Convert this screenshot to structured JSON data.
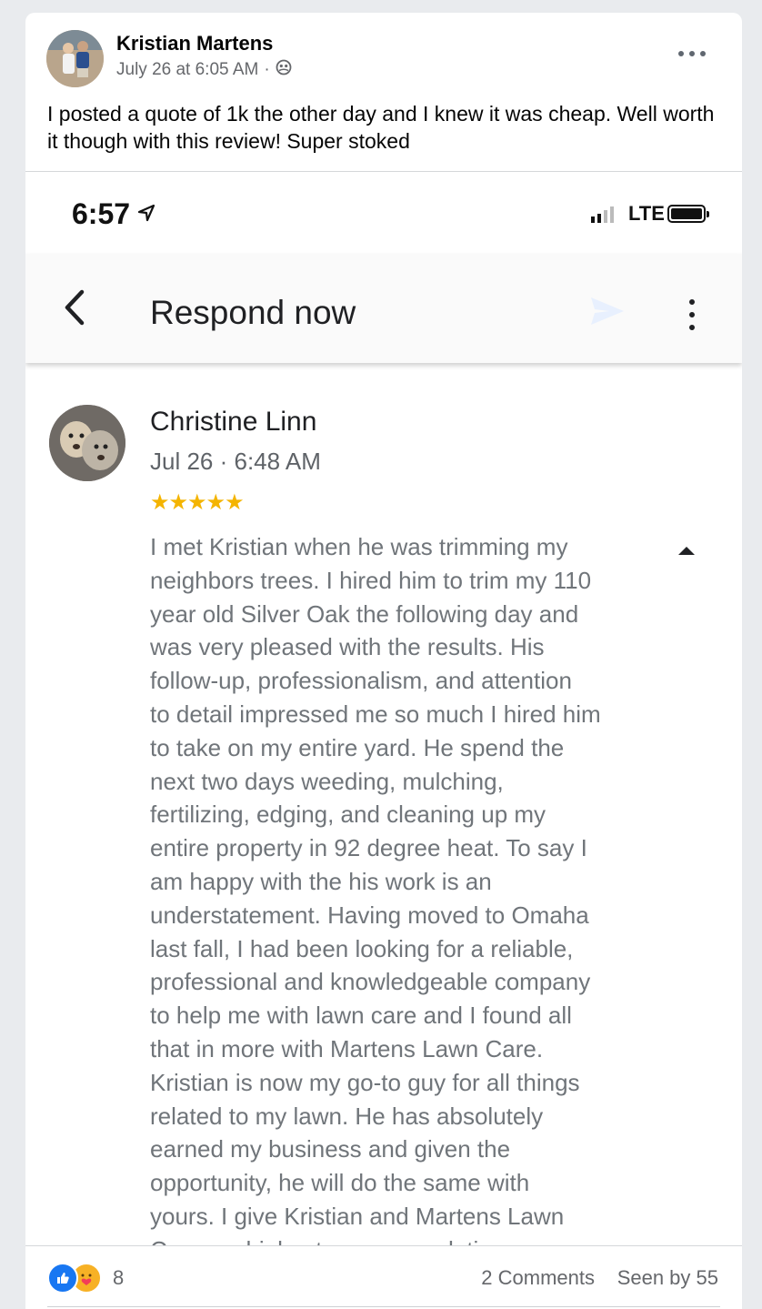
{
  "post": {
    "author": "Kristian Martens",
    "timestamp": "July 26 at 6:05 AM",
    "separator": "·",
    "audience_icon": "friends-icon",
    "text": "I posted a quote of 1k the other day and I knew it was cheap. Well worth it though with this review! Super stoked"
  },
  "phone": {
    "time": "6:57",
    "network": "LTE"
  },
  "app_bar": {
    "title": "Respond now"
  },
  "review": {
    "name": "Christine Linn",
    "date": "Jul 26 · 6:48 AM",
    "stars": "★★★★★",
    "rating": 5,
    "text": "I met Kristian when he was trimming my\nneighbors trees. I hired him to trim my 110\nyear old Silver Oak the following day and\nwas very pleased with the results.  His\nfollow-up, professionalism, and attention\nto detail impressed me so much I hired him\nto take on my entire yard. He spend the\nnext two days weeding, mulching,\nfertilizing, edging, and cleaning up my\nentire property in 92 degree heat. To say I\nam happy with the his work is an\nunderstatement. Having moved to Omaha\nlast fall, I had been looking for a reliable,\nprofessional and knowledgeable company\nto help me with lawn care and I found all\nthat in more with Martens Lawn Care.\nKristian is now my go-to guy for all things\nrelated to my lawn. He has absolutely\nearned my business and given the\nopportunity, he will do the same with\nyours. I give Kristian and Martens Lawn\nCare my highest recommendation."
  },
  "footer": {
    "reaction_count": "8",
    "comments": "2 Comments",
    "seen": "Seen by 55"
  },
  "colors": {
    "like_blue": "#1877f2",
    "star_gold": "#f4b400",
    "care_yellow": "#f7b125"
  }
}
